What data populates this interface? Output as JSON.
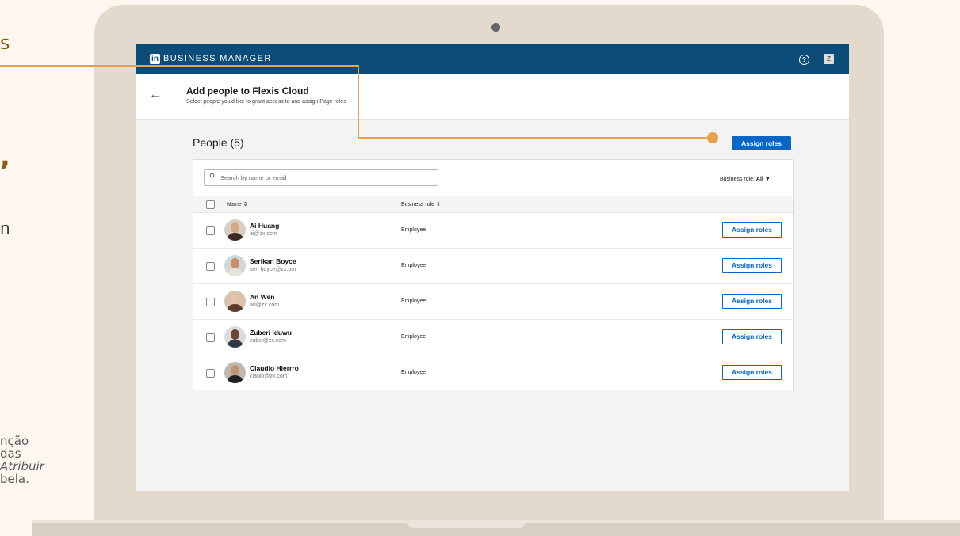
{
  "slide_fragments": {
    "s": "s",
    "comma": ",",
    "n": "n",
    "para_line1": "nção",
    "para_line2": "das",
    "para_line3_italic": "Atribuir",
    "para_line4": "bela."
  },
  "app": {
    "logo_text": "in",
    "brand": "BUSINESS MANAGER",
    "help_icon": "help-icon",
    "user_initial": "Z"
  },
  "page_header": {
    "back_icon": "←",
    "title": "Add people to Flexis Cloud",
    "subtitle": "Select people you'd like to grant access to and assign Page roles"
  },
  "people": {
    "title": "People (5)",
    "assign_button": "Assign roles",
    "search_placeholder": "Search by name or email",
    "filter_label": "Business role:",
    "filter_value": "All",
    "columns": [
      "Name",
      "Business role"
    ],
    "rows": [
      {
        "name": "Ai Huang",
        "email": "ai@zx.com",
        "role": "Employee",
        "action": "Assign roles"
      },
      {
        "name": "Serikan Boyce",
        "email": "ser_boyce@zx.om",
        "role": "Employee",
        "action": "Assign roles"
      },
      {
        "name": "An Wen",
        "email": "an@zx.com",
        "role": "Employee",
        "action": "Assign roles"
      },
      {
        "name": "Zuberi Iduwu",
        "email": "zubei@zx.com",
        "role": "Employee",
        "action": "Assign roles"
      },
      {
        "name": "Claudio Hierrro",
        "email": "clauio@zx.com",
        "role": "Employee",
        "action": "Assign roles"
      }
    ]
  },
  "colors": {
    "topbar": "#0b4c79",
    "primary": "#0a66c2",
    "callout": "#e7a14a",
    "slide_accent": "#8a5a16"
  }
}
